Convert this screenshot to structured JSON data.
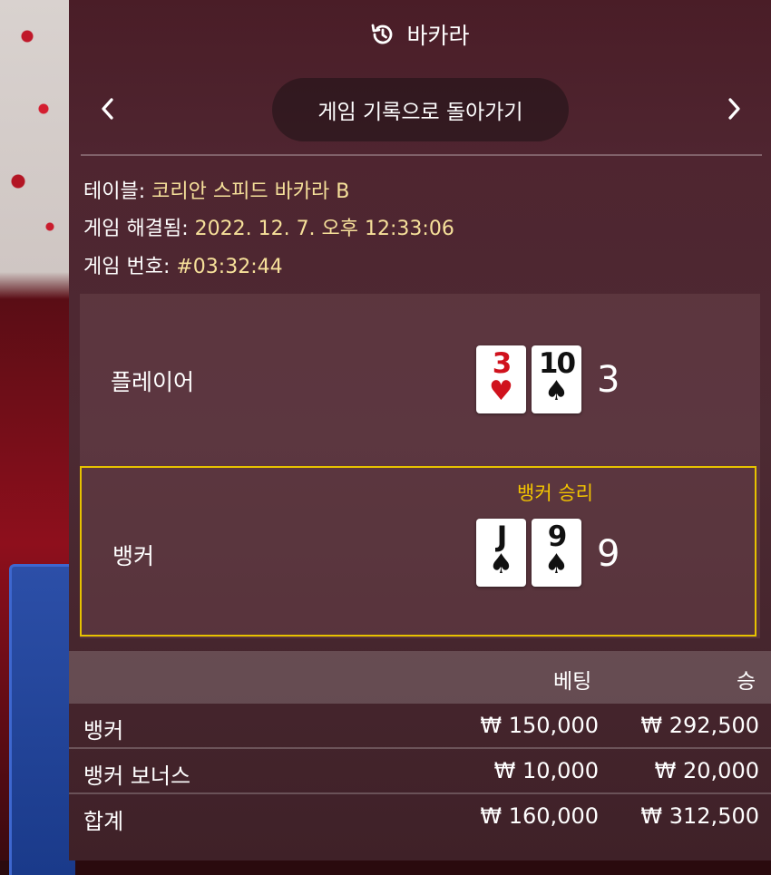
{
  "header": {
    "title": "바카라",
    "icon": "history-icon"
  },
  "nav": {
    "back_label": "게임 기록으로 돌아가기",
    "prev_icon": "‹",
    "next_icon": "›"
  },
  "info": {
    "table_label": "테이블:",
    "table_value": "코리안 스피드 바카라 B",
    "resolved_label": "게임 해결됨:",
    "resolved_value": "2022. 12. 7. 오후 12:33:06",
    "game_label": "게임 번호:",
    "game_value": "#03:32:44"
  },
  "player": {
    "label": "플레이어",
    "cards": [
      {
        "rank": "3",
        "suit": "♥",
        "color": "red"
      },
      {
        "rank": "10",
        "suit": "♠",
        "color": "black"
      }
    ],
    "score": "3"
  },
  "banker": {
    "label": "뱅커",
    "win_label": "뱅커 승리",
    "cards": [
      {
        "rank": "J",
        "suit": "♠",
        "color": "black"
      },
      {
        "rank": "9",
        "suit": "♠",
        "color": "black"
      }
    ],
    "score": "9"
  },
  "bets": {
    "headers": {
      "bet": "베팅",
      "win": "승"
    },
    "rows": [
      {
        "name": "뱅커",
        "bet": "₩ 150,000",
        "win": "₩ 292,500"
      },
      {
        "name": "뱅커 보너스",
        "bet": "₩ 10,000",
        "win": "₩ 20,000"
      },
      {
        "name": "합계",
        "bet": "₩ 160,000",
        "win": "₩ 312,500"
      }
    ]
  },
  "colors": {
    "accent_gold": "#e6c200",
    "info_value": "#f6e09a",
    "card_red": "#d0121d"
  }
}
